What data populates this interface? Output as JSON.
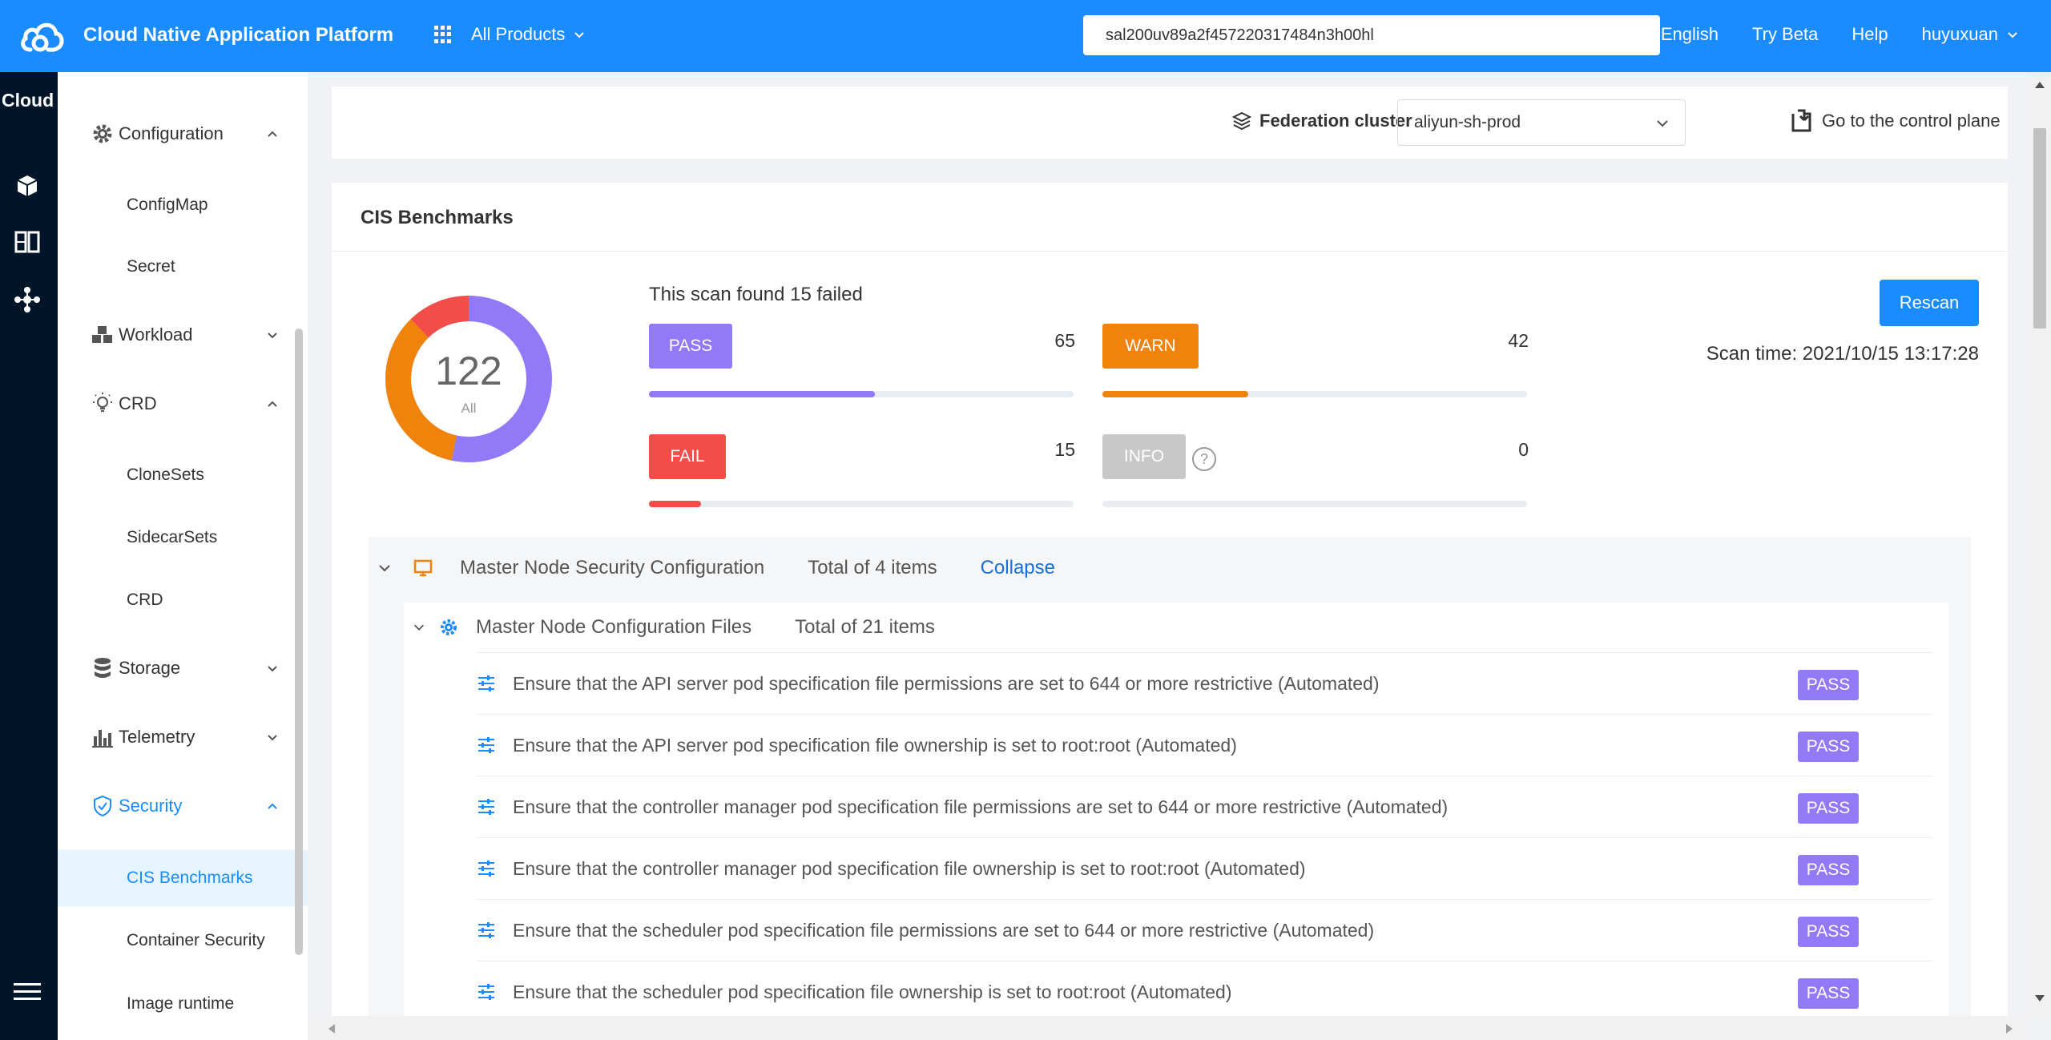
{
  "header": {
    "title": "Cloud Native Application Platform",
    "products_label": "All Products",
    "search_value": "sal200uv89a2f457220317484n3h00hl",
    "links": [
      "English",
      "Try Beta",
      "Help",
      "huyuxuan"
    ]
  },
  "rail": {
    "title": "Cloud"
  },
  "sidebar": {
    "configuration": "Configuration",
    "configmap": "ConfigMap",
    "secret": "Secret",
    "workload": "Workload",
    "crd_group": "CRD",
    "clonesets": "CloneSets",
    "sidecarsets": "SidecarSets",
    "crd": "CRD",
    "storage": "Storage",
    "telemetry": "Telemetry",
    "security": "Security",
    "cis_benchmarks": "CIS Benchmarks",
    "container_security": "Container Security",
    "image_runtime": "Image runtime"
  },
  "federation": {
    "label": "Federation cluster",
    "selected": "aliyun-sh-prod",
    "control_plane": "Go to the control plane"
  },
  "benchmark": {
    "title": "CIS Benchmarks",
    "total": "122",
    "total_label": "All",
    "scan_summary": "This scan found 15 failed",
    "rescan": "Rescan",
    "scan_time": "Scan time: 2021/10/15 13:17:28",
    "stats": [
      {
        "label": "PASS",
        "count": "65",
        "value": 65,
        "color": "#9179f7"
      },
      {
        "label": "WARN",
        "count": "42",
        "value": 42,
        "color": "#f0830c"
      },
      {
        "label": "FAIL",
        "count": "15",
        "value": 15,
        "color": "#f34d4a"
      },
      {
        "label": "INFO",
        "count": "0",
        "value": 0,
        "color": "#c8c8c8"
      }
    ],
    "help": "?"
  },
  "section": {
    "name": "Master Node Security Configuration",
    "total": "Total of 4 items",
    "collapse": "Collapse",
    "sub_name": "Master Node Configuration Files",
    "sub_total": "Total of 21 items",
    "rows": [
      {
        "text": "Ensure that the API server pod specification file permissions are set to 644 or more restrictive (Automated)",
        "status": "PASS"
      },
      {
        "text": "Ensure that the API server pod specification file ownership is set to root:root (Automated)",
        "status": "PASS"
      },
      {
        "text": "Ensure that the controller manager pod specification file permissions are set to 644 or more restrictive (Automated)",
        "status": "PASS"
      },
      {
        "text": "Ensure that the controller manager pod specification file ownership is set to root:root (Automated)",
        "status": "PASS"
      },
      {
        "text": "Ensure that the scheduler pod specification file permissions are set to 644 or more restrictive (Automated)",
        "status": "PASS"
      },
      {
        "text": "Ensure that the scheduler pod specification file ownership is set to root:root (Automated)",
        "status": "PASS"
      }
    ]
  },
  "colors": {
    "primary": "#1a8cff",
    "rail": "#001529",
    "pass": "#9179f7",
    "warn": "#f0830c",
    "fail": "#f34d4a",
    "info": "#c8c8c8"
  }
}
